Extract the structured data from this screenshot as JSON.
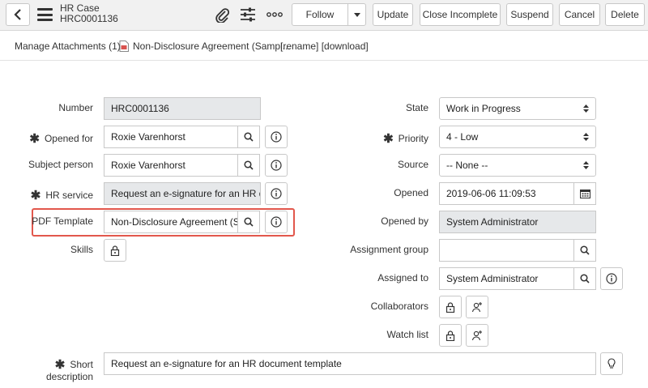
{
  "header": {
    "record_type": "HR Case",
    "record_number": "HRC0001136",
    "buttons": {
      "follow": "Follow",
      "update": "Update",
      "close_incomplete": "Close Incomplete",
      "suspend": "Suspend",
      "cancel": "Cancel",
      "delete": "Delete"
    }
  },
  "attachments": {
    "label": "Manage Attachments (1):",
    "file_name": "Non-Disclosure Agreement (Sampl...",
    "actions": "[rename] [download]"
  },
  "form": {
    "left": {
      "number": {
        "label": "Number",
        "value": "HRC0001136"
      },
      "opened_for": {
        "label": "Opened for",
        "value": "Roxie Varenhorst"
      },
      "subject_person": {
        "label": "Subject person",
        "value": "Roxie Varenhorst"
      },
      "hr_service": {
        "label": "HR service",
        "value": "Request an e-signature for an HR doc"
      },
      "pdf_template": {
        "label": "PDF Template",
        "value": "Non-Disclosure Agreement (Sar"
      },
      "skills": {
        "label": "Skills"
      }
    },
    "right": {
      "state": {
        "label": "State",
        "value": "Work in Progress"
      },
      "priority": {
        "label": "Priority",
        "value": "4 - Low"
      },
      "source": {
        "label": "Source",
        "value": "-- None --"
      },
      "opened": {
        "label": "Opened",
        "value": "2019-06-06 11:09:53"
      },
      "opened_by": {
        "label": "Opened by",
        "value": "System Administrator"
      },
      "assignment_group": {
        "label": "Assignment group",
        "value": ""
      },
      "assigned_to": {
        "label": "Assigned to",
        "value": "System Administrator"
      },
      "collaborators": {
        "label": "Collaborators"
      },
      "watch_list": {
        "label": "Watch list"
      }
    },
    "short_description": {
      "label_line1": "Short",
      "label_line2": "description",
      "value": "Request an e-signature for an HR document template"
    },
    "required_marker": "✱"
  },
  "colors": {
    "header_bg": "#f1f1f1",
    "readonly_bg": "#e6e8ea",
    "highlight": "#e2574c",
    "pdf_icon": "#d9534f"
  }
}
